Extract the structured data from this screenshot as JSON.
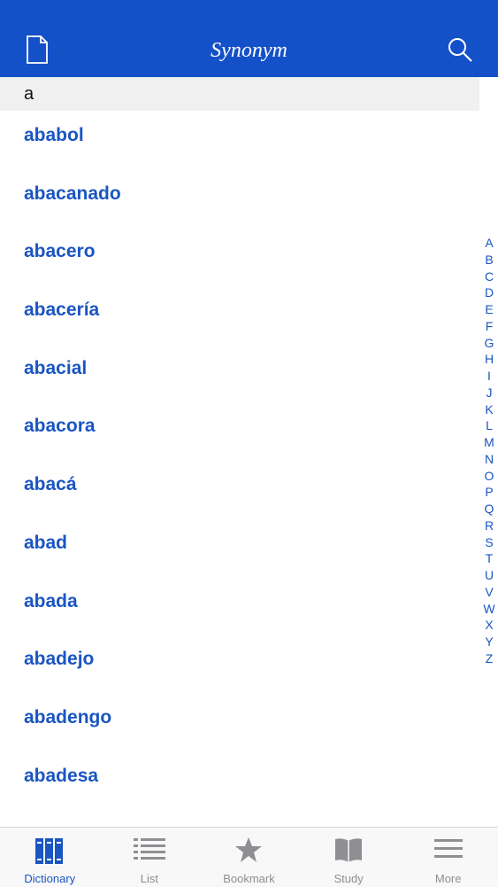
{
  "header": {
    "title": "Synonym"
  },
  "section": {
    "letter": "a"
  },
  "words": [
    "ababol",
    "abacanado",
    "abacero",
    "abacería",
    "abacial",
    "abacora",
    "abacá",
    "abad",
    "abada",
    "abadejo",
    "abadengo",
    "abadesa"
  ],
  "index": [
    "A",
    "B",
    "C",
    "D",
    "E",
    "F",
    "G",
    "H",
    "I",
    "J",
    "K",
    "L",
    "M",
    "N",
    "O",
    "P",
    "Q",
    "R",
    "S",
    "T",
    "U",
    "V",
    "W",
    "X",
    "Y",
    "Z"
  ],
  "tabs": [
    {
      "label": "Dictionary",
      "icon": "dictionary-books-icon",
      "active": true
    },
    {
      "label": "List",
      "icon": "list-icon",
      "active": false
    },
    {
      "label": "Bookmark",
      "icon": "star-icon",
      "active": false
    },
    {
      "label": "Study",
      "icon": "open-book-icon",
      "active": false
    },
    {
      "label": "More",
      "icon": "hamburger-menu-icon",
      "active": false
    }
  ],
  "colors": {
    "nav": "#1450c8",
    "accent": "#1a55c2",
    "inactive": "#8e8e93"
  }
}
